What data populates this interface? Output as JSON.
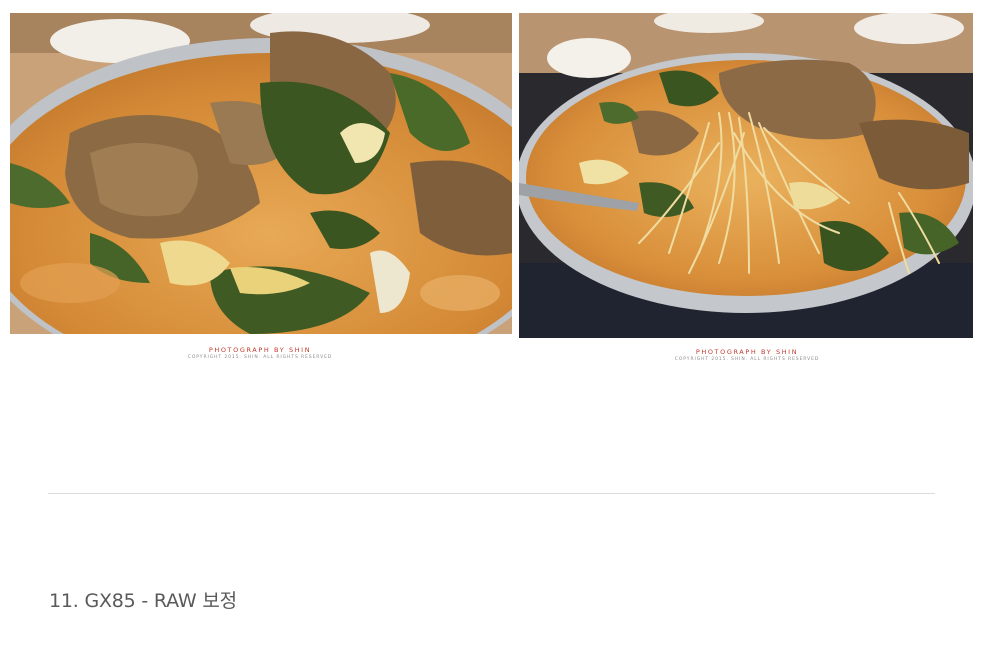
{
  "photos": [
    {
      "watermark_title": "PHOTOGRAPH BY SHIN",
      "watermark_copyright": "COPYRIGHT 2015. SHIN. ALL RIGHTS RESERVED"
    },
    {
      "watermark_title": "PHOTOGRAPH BY SHIN",
      "watermark_copyright": "COPYRIGHT 2015. SHIN. ALL RIGHTS RESERVED"
    }
  ],
  "section": {
    "heading": "11. GX85 - RAW 보정"
  },
  "colors": {
    "broth": "#d9913c",
    "pot": "#b9bcc0",
    "greens": "#3f5a23",
    "meat": "#8a6a45",
    "watermark_red": "#c0392b",
    "heading": "#5a5a5a",
    "divider": "#dcdcdc"
  }
}
